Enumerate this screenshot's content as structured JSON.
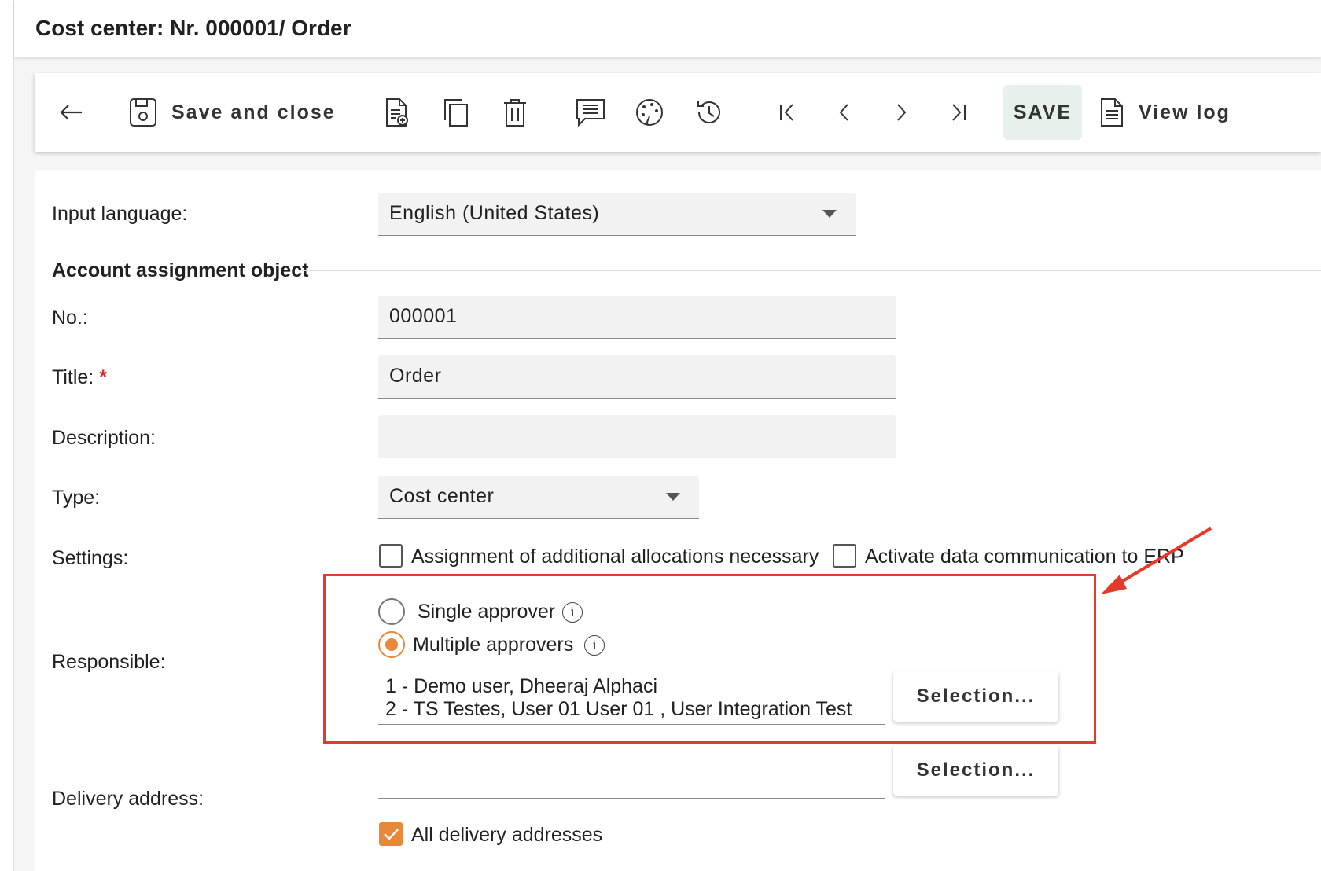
{
  "window": {
    "title": "Cost center: Nr. 000001/ Order"
  },
  "toolbar": {
    "back_icon": "arrow-left-icon",
    "save_close_label": "Save and close",
    "save_label": "SAVE",
    "view_log_label": "View log",
    "icons": [
      "new-document-icon",
      "copy-icon",
      "delete-icon",
      "comment-icon",
      "palette-icon",
      "history-icon",
      "first-record-icon",
      "previous-record-icon",
      "next-record-icon",
      "last-record-icon"
    ]
  },
  "form": {
    "input_language": {
      "label": "Input language:",
      "value": "English (United States)"
    },
    "section_title": "Account assignment object",
    "no": {
      "label": "No.:",
      "value": "000001"
    },
    "title": {
      "label": "Title:",
      "required_mark": "*",
      "value": "Order"
    },
    "description": {
      "label": "Description:",
      "value": ""
    },
    "type": {
      "label": "Type:",
      "value": "Cost center"
    },
    "settings": {
      "label": "Settings:",
      "options": [
        {
          "label": "Assignment of additional allocations necessary",
          "checked": false
        },
        {
          "label": "Activate data communication to ERP",
          "checked": false
        }
      ]
    },
    "responsible": {
      "label": "Responsible:",
      "single_label": "Single approver",
      "multiple_label": "Multiple approvers",
      "selected": "multiple",
      "approvers": [
        "1 - Demo user, Dheeraj Alphaci",
        "2 - TS Testes, User 01 User 01 , User Integration Test"
      ],
      "selection_button": "Selection..."
    },
    "delivery_address": {
      "label": "Delivery address:",
      "value": "",
      "selection_button": "Selection...",
      "all_addresses_label": "All delivery addresses",
      "all_addresses_checked": true
    }
  },
  "colors": {
    "accent": "#e8893a",
    "highlight": "#e53a2a",
    "save_bg": "#e8f0ec"
  }
}
